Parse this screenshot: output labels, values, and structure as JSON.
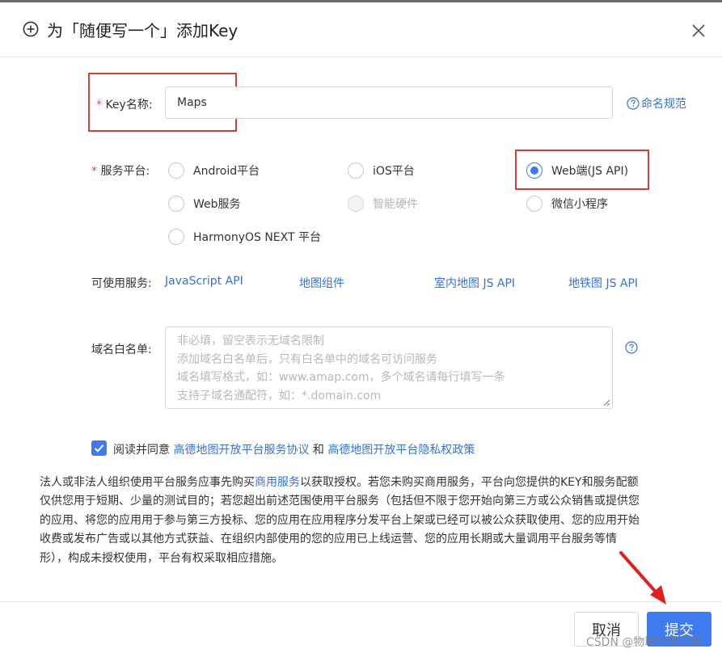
{
  "dialog": {
    "title": "为「随便写一个」添加Key",
    "plus_icon": "plus-circle-icon",
    "close_icon": "close-icon"
  },
  "colors": {
    "accent": "#3f7bef",
    "link": "#3472d8",
    "required": "#e34d4d",
    "highlight_box": "#d93a3a"
  },
  "key_name": {
    "required_mark": "*",
    "label": "Key名称:",
    "value": "Maps",
    "naming_link": "命名规范"
  },
  "platform": {
    "required_mark": "*",
    "label": "服务平台:",
    "options": [
      {
        "label": "Android平台",
        "checked": false,
        "disabled": false
      },
      {
        "label": "iOS平台",
        "checked": false,
        "disabled": false
      },
      {
        "label": "Web端(JS API)",
        "checked": true,
        "disabled": false
      },
      {
        "label": "Web服务",
        "checked": false,
        "disabled": false
      },
      {
        "label": "智能硬件",
        "checked": false,
        "disabled": true
      },
      {
        "label": "微信小程序",
        "checked": false,
        "disabled": false
      },
      {
        "label": "HarmonyOS NEXT 平台",
        "checked": false,
        "disabled": false
      }
    ]
  },
  "services": {
    "label": "可使用服务:",
    "items": [
      "JavaScript API",
      "地图组件",
      "室内地图 JS API",
      "地铁图 JS API"
    ]
  },
  "whitelist": {
    "label": "域名白名单:",
    "placeholder_lines": [
      "非必填，留空表示无域名限制",
      "添加域名白名单后，只有白名单中的域名可访问服务",
      "域名填写格式，如：www.amap.com，多个域名请每行填写一条",
      "支持子域名通配符，如：*.domain.com"
    ]
  },
  "agreement": {
    "checked": true,
    "prefix": "阅读并同意",
    "link1": "高德地图开放平台服务协议",
    "and": "和",
    "link2": "高德地图开放平台隐私权政策"
  },
  "notice": {
    "line1_a": "法人或非法人组织使用平台服务应事先购买",
    "line1_link": "商用服务",
    "line1_b": "以获取授权。若您未购买商用服务，平台向您提供的KEY和服务配额",
    "line2": "仅供您用于短期、少量的测试目的；若您超出前述范围使用平台服务（包括但不限于您开始向第三方或公众销售或提供您",
    "line3": "的应用、将您的应用用于参与第三方投标、您的应用在应用程序分发平台上架或已经可以被公众获取使用、您的应用开始",
    "line4": "收费或发布广告或以其他方式获益、在组织内部使用的您的应用已上线运营、您的应用长期或大量调用平台服务等情",
    "line5": "形），构成未授权使用，平台有权采取相应措施。"
  },
  "footer": {
    "cancel": "取消",
    "submit": "提交"
  },
  "watermark": "CSDN @物联网不互联"
}
